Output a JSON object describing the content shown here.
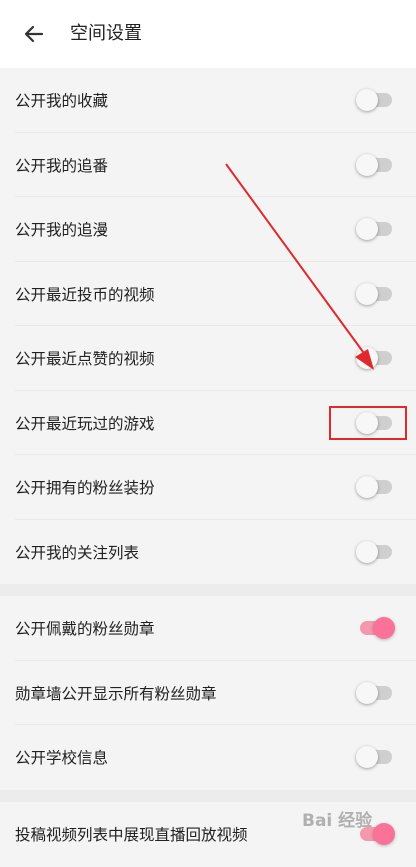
{
  "header": {
    "title": "空间设置",
    "back_icon": "arrow-left-icon"
  },
  "groups": [
    {
      "items": [
        {
          "label": "公开我的收藏",
          "enabled": false
        },
        {
          "label": "公开我的追番",
          "enabled": false
        },
        {
          "label": "公开我的追漫",
          "enabled": false
        },
        {
          "label": "公开最近投币的视频",
          "enabled": false
        },
        {
          "label": "公开最近点赞的视频",
          "enabled": false
        },
        {
          "label": "公开最近玩过的游戏",
          "enabled": false
        },
        {
          "label": "公开拥有的粉丝装扮",
          "enabled": false
        },
        {
          "label": "公开我的关注列表",
          "enabled": false
        }
      ]
    },
    {
      "items": [
        {
          "label": "公开佩戴的粉丝勋章",
          "enabled": true
        },
        {
          "label": "勋章墙公开显示所有粉丝勋章",
          "enabled": false
        },
        {
          "label": "公开学校信息",
          "enabled": false
        }
      ]
    },
    {
      "items": [
        {
          "label": "投稿视频列表中展现直播回放视频",
          "enabled": true
        }
      ]
    }
  ],
  "annotation": {
    "highlighted_item": "公开最近玩过的游戏",
    "color": "#e0292d"
  },
  "watermark": {
    "text": "Bai 经验"
  },
  "colors": {
    "accent": "#fb7299",
    "toggle_off": "#cfcfcf"
  }
}
